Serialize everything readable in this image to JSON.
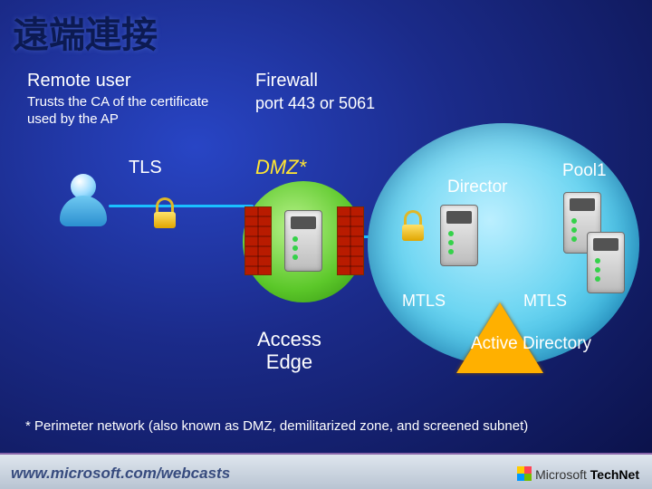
{
  "title": "遠端連接",
  "remote": {
    "heading": "Remote user",
    "sub": "Trusts the CA of the certificate used by the AP"
  },
  "tls": "TLS",
  "firewall": {
    "heading": "Firewall",
    "ports": "port 443 or 5061"
  },
  "dmz": "DMZ*",
  "internal": {
    "director": "Director",
    "pool1": "Pool1",
    "mtls1": "MTLS",
    "mtls2": "MTLS",
    "ad": "Active Directory"
  },
  "access_edge_l1": "Access",
  "access_edge_l2": "Edge",
  "footnote": "* Perimeter network (also known as DMZ, demilitarized zone, and screened subnet)",
  "footer": {
    "url": "www.microsoft.com/webcasts",
    "brand_prefix": "Microsoft ",
    "brand_bold": "TechNet"
  }
}
